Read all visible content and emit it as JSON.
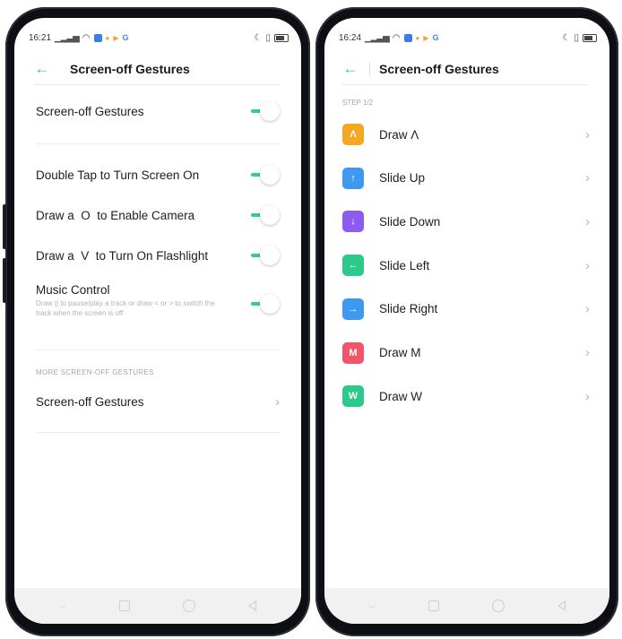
{
  "left_phone": {
    "status": {
      "time": "16:21"
    },
    "title": "Screen-off Gestures",
    "rows": [
      {
        "label": "Screen-off Gestures",
        "enabled": true
      },
      {
        "label": "Double Tap to Turn Screen On",
        "enabled": true
      },
      {
        "label": "Draw a  O  to Enable Camera",
        "enabled": true
      },
      {
        "label": "Draw a  V  to Turn On Flashlight",
        "enabled": true
      },
      {
        "label": "Music Control",
        "enabled": true,
        "description": "Draw || to pause/play a track or draw < or > to switch the track when the screen is off"
      }
    ],
    "section_header": "MORE SCREEN-OFF GESTURES",
    "link_row": "Screen-off Gestures"
  },
  "right_phone": {
    "status": {
      "time": "16:24"
    },
    "title": "Screen-off Gestures",
    "step": "STEP 1/2",
    "gestures": [
      {
        "label": "Draw Λ",
        "icon_glyph": "Λ",
        "icon": "caret-up-icon",
        "color": "#f5a623"
      },
      {
        "label": "Slide Up",
        "icon_glyph": "↑",
        "icon": "arrow-up-icon",
        "color": "#3d9af0"
      },
      {
        "label": "Slide Down",
        "icon_glyph": "↓",
        "icon": "arrow-down-icon",
        "color": "#8b5cf0"
      },
      {
        "label": "Slide Left",
        "icon_glyph": "←",
        "icon": "arrow-left-icon",
        "color": "#2dc98a"
      },
      {
        "label": "Slide Right",
        "icon_glyph": "→",
        "icon": "arrow-right-icon",
        "color": "#3d9af0"
      },
      {
        "label": "Draw M",
        "icon_glyph": "M",
        "icon": "letter-m-icon",
        "color": "#f0566a"
      },
      {
        "label": "Draw W",
        "icon_glyph": "W",
        "icon": "letter-w-icon",
        "color": "#2dc98a"
      }
    ]
  },
  "colors": {
    "accent": "#28c48c",
    "toggle_on": "#2ed18f"
  }
}
